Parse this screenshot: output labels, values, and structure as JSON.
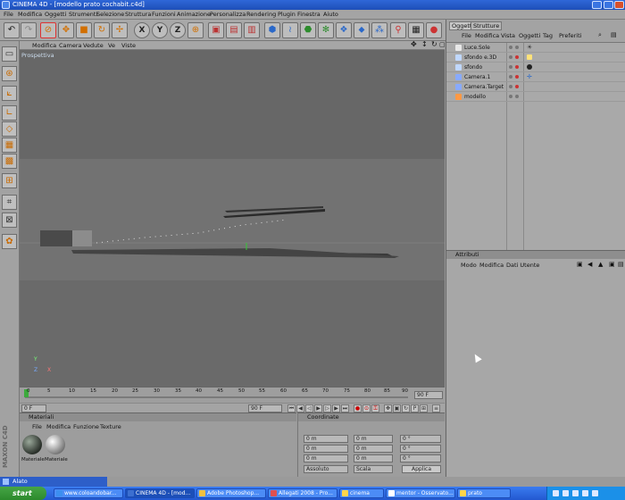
{
  "window": {
    "title": "CINEMA 4D - [modello prato cochabit.c4d]"
  },
  "menubar": {
    "items": [
      "File",
      "Modifica",
      "Oggetti",
      "Strumenti",
      "Selezione",
      "Struttura",
      "Funzioni",
      "Animazione",
      "Personalizza",
      "Rendering",
      "Plugin",
      "Finestra",
      "Aiuto"
    ]
  },
  "viewport": {
    "menu": [
      "Modifica",
      "Camera",
      "Vedute",
      "Ve",
      "Viste"
    ],
    "label": "Prospettiva",
    "axes": {
      "y": "Y",
      "z": "Z",
      "x": "X"
    }
  },
  "timeline": {
    "ticks": [
      "0",
      "5",
      "10",
      "15",
      "20",
      "25",
      "30",
      "35",
      "40",
      "45",
      "50",
      "55",
      "60",
      "65",
      "70",
      "75",
      "80",
      "85",
      "90"
    ],
    "frame_end": "90 F"
  },
  "playbar": {
    "current": "0 F",
    "end": "90 F"
  },
  "material_panel": {
    "title": "Materiali",
    "menu": [
      "File",
      "Modifica",
      "Funzione",
      "Texture"
    ],
    "materials": [
      {
        "name": "Materiale"
      },
      {
        "name": "Materiale"
      }
    ]
  },
  "coord_panel": {
    "title": "Coordinate",
    "rows": [
      {
        "a": "0 m",
        "b": "0 m",
        "c": "0 °"
      },
      {
        "a": "0 m",
        "b": "0 m",
        "c": "0 °"
      },
      {
        "a": "0 m",
        "b": "0 m",
        "c": "0 °"
      }
    ],
    "mode_left": "Assoluto",
    "mode_right": "Scala",
    "apply": "Applica"
  },
  "object_manager": {
    "tabs": [
      "Oggetti",
      "Strutture"
    ],
    "menu": [
      "File",
      "Modifica",
      "Vista",
      "Oggetti",
      "Tag",
      "Preferiti"
    ],
    "objects": [
      {
        "name": "Luce.Sole",
        "icon_color": "#e8e8e8"
      },
      {
        "name": "sfondo e.3D",
        "icon_color": "#c0d8ff"
      },
      {
        "name": "sfondo",
        "icon_color": "#c0d8ff"
      },
      {
        "name": "Camera.1",
        "icon_color": "#88aaff"
      },
      {
        "name": "Camera.Target",
        "icon_color": "#88aaff"
      },
      {
        "name": "modello",
        "icon_color": "#ff9944"
      }
    ]
  },
  "attribute_manager": {
    "title": "Attributi",
    "menu": [
      "Modo",
      "Modifica",
      "Dati Utente"
    ]
  },
  "alto_window": {
    "label": "Alato"
  },
  "taskbar": {
    "start": "start",
    "tasks": [
      {
        "label": "www.coloandobar...",
        "active": false
      },
      {
        "label": "CINEMA 4D - [mod...",
        "active": true
      },
      {
        "label": "Adobe Photoshop...",
        "active": false
      },
      {
        "label": "Allegati 2008 - Pro...",
        "active": false
      },
      {
        "label": "cinema",
        "active": false
      },
      {
        "label": "mentor - Osservato...",
        "active": false
      },
      {
        "label": "prato",
        "active": false
      }
    ]
  },
  "colors": {
    "title_bar": "#2357c8",
    "viewport_bg": "#6f6f6f",
    "panel_bg": "#a3a3a3",
    "accent_orange": "#d26f00"
  }
}
